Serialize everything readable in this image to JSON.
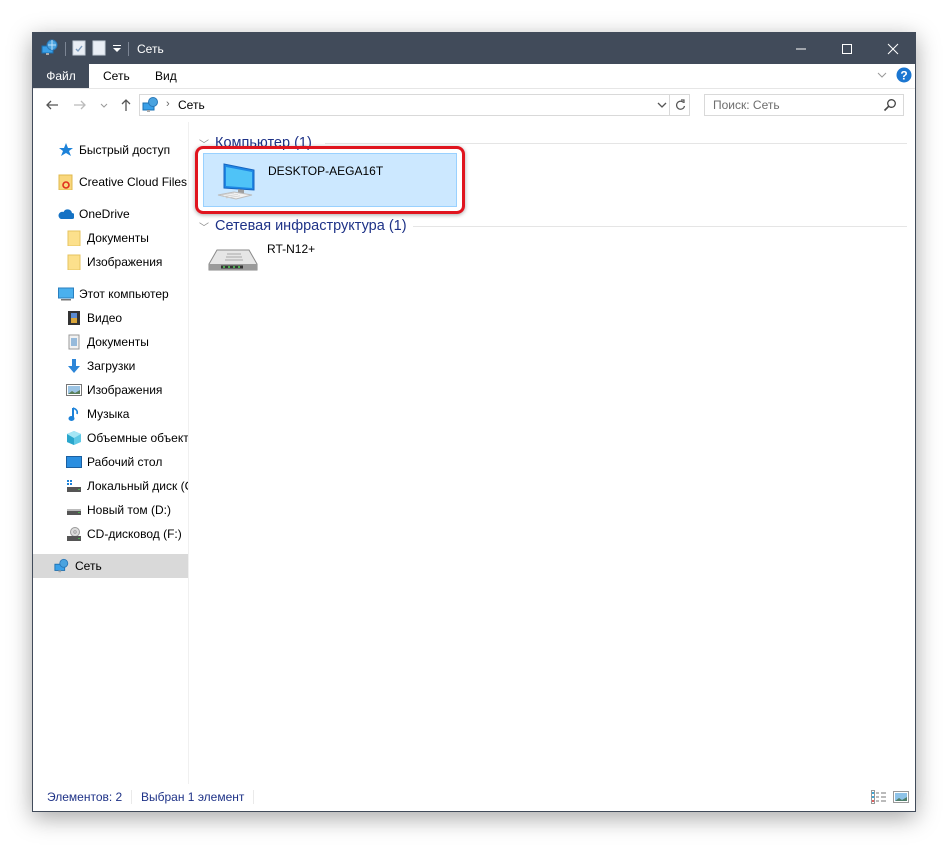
{
  "window": {
    "title": "Сеть",
    "controls": {
      "minimize": "minimize",
      "maximize": "maximize",
      "close": "close"
    }
  },
  "ribbon": {
    "tabs": [
      {
        "label": "Файл",
        "active": true
      },
      {
        "label": "Сеть"
      },
      {
        "label": "Вид"
      }
    ]
  },
  "navigation": {
    "address": {
      "location": "Сеть"
    },
    "search": {
      "placeholder": "Поиск: Сеть"
    }
  },
  "sidebar": {
    "items": [
      {
        "label": "Быстрый доступ",
        "icon": "star-icon",
        "level": 0
      },
      {
        "label": "Creative Cloud Files",
        "icon": "creative-cloud-folder-icon",
        "level": 0
      },
      {
        "label": "OneDrive",
        "icon": "cloud-icon",
        "level": 0
      },
      {
        "label": "Документы",
        "icon": "folder-icon",
        "level": 1
      },
      {
        "label": "Изображения",
        "icon": "folder-icon",
        "level": 1
      },
      {
        "label": "Этот компьютер",
        "icon": "computer-icon",
        "level": 0
      },
      {
        "label": "Видео",
        "icon": "video-icon",
        "level": 1
      },
      {
        "label": "Документы",
        "icon": "document-icon",
        "level": 1
      },
      {
        "label": "Загрузки",
        "icon": "download-icon",
        "level": 1
      },
      {
        "label": "Изображения",
        "icon": "pictures-icon",
        "level": 1
      },
      {
        "label": "Музыка",
        "icon": "music-icon",
        "level": 1
      },
      {
        "label": "Объемные объекты",
        "icon": "3d-objects-icon",
        "level": 1
      },
      {
        "label": "Рабочий стол",
        "icon": "desktop-icon",
        "level": 1
      },
      {
        "label": "Локальный диск (C:)",
        "icon": "system-drive-icon",
        "level": 1
      },
      {
        "label": "Новый том (D:)",
        "icon": "drive-icon",
        "level": 1
      },
      {
        "label": "CD-дисковод (F:)",
        "icon": "cd-drive-icon",
        "level": 1
      },
      {
        "label": "Сеть",
        "icon": "network-icon",
        "level": 0,
        "selected": true
      }
    ]
  },
  "content": {
    "groups": [
      {
        "header": "Компьютер (1)",
        "items": [
          {
            "name": "DESKTOP-AEGA16T",
            "icon": "computer-icon",
            "selected": true
          }
        ]
      },
      {
        "header": "Сетевая инфраструктура (1)",
        "items": [
          {
            "name": "RT-N12+",
            "icon": "router-icon"
          }
        ]
      }
    ]
  },
  "statusbar": {
    "count": "Элементов: 2",
    "selection": "Выбран 1 элемент"
  },
  "colors": {
    "titlebar": "#414b5a",
    "accent": "#1e3287",
    "selection": "#cce8ff",
    "highlight": "#e0141e"
  }
}
